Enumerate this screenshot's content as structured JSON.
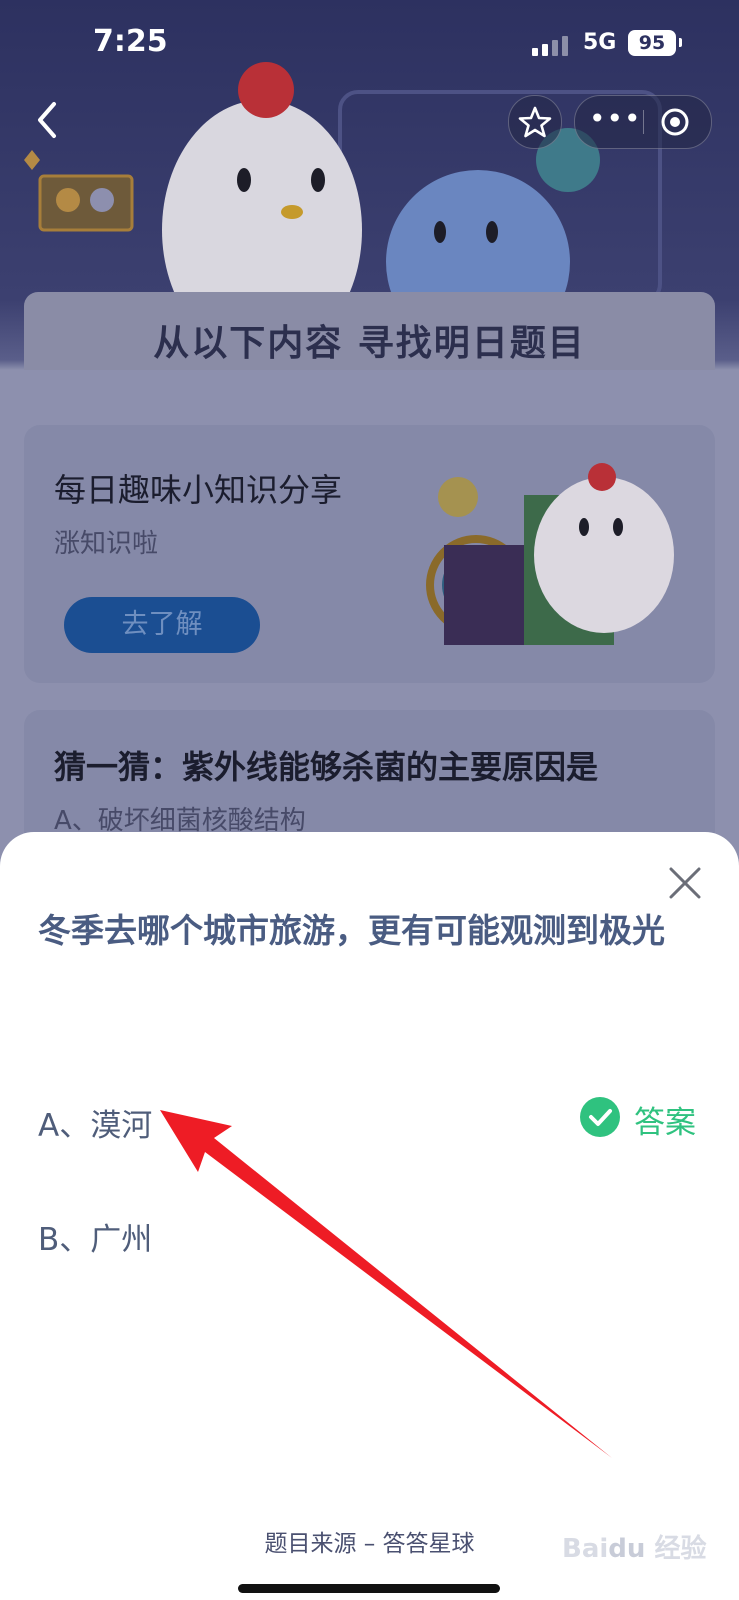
{
  "status_bar": {
    "time": "7:25",
    "network": "5G",
    "battery": "95"
  },
  "hero": {
    "title": "从以下内容 寻找明日题目"
  },
  "card_fun_fact": {
    "title": "每日趣味小知识分享",
    "subtitle": "涨知识啦",
    "button": "去了解"
  },
  "card_guess": {
    "title": "猜一猜：紫外线能够杀菌的主要原因是",
    "option_a": "A、破坏细菌核酸结构"
  },
  "sheet": {
    "question": "冬季去哪个城市旅游，更有可能观测到极光",
    "options": [
      {
        "label": "A、漠河",
        "correct": true
      },
      {
        "label": "B、广州",
        "correct": false
      }
    ],
    "answer_label": "答案",
    "footer": "题目来源 – 答答星球"
  },
  "watermark": "Baidu 经验",
  "colors": {
    "accent_green": "#2fc27f",
    "question_text": "#4a5c82",
    "annotation_arrow": "#ee1c25"
  },
  "icons": [
    "back-arrow-icon",
    "star-icon",
    "more-dots-icon",
    "target-icon",
    "close-icon",
    "checkmark-icon"
  ]
}
